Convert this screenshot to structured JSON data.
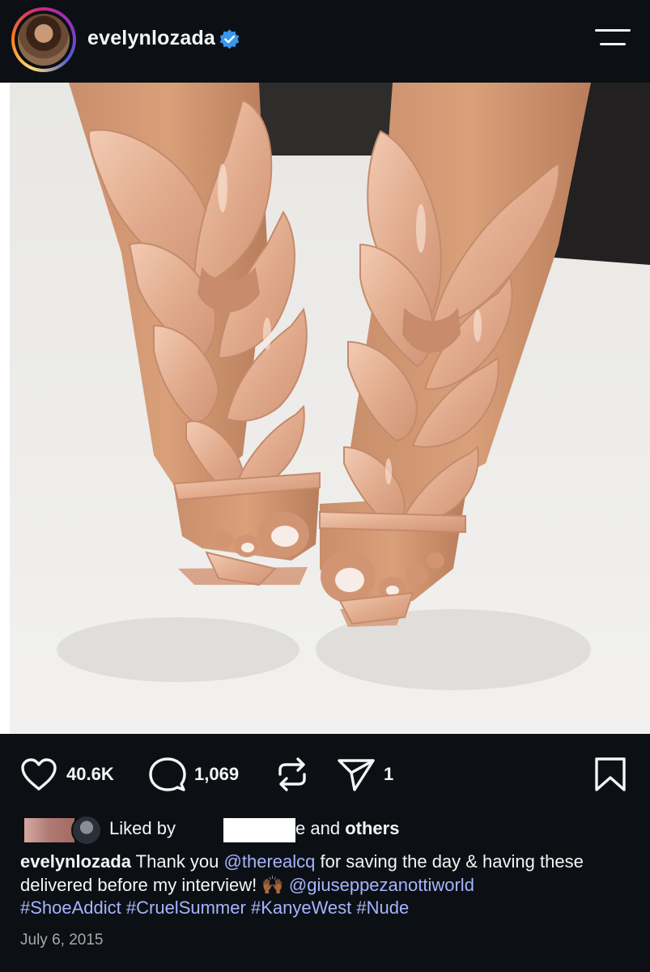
{
  "header": {
    "username": "evelynlozada",
    "verified_icon": "verified-badge-icon",
    "menu_icon": "menu-icon",
    "accent": "#3897f0"
  },
  "post": {
    "image_alt_icon": "photo-sandals"
  },
  "actions": {
    "likes": "40.6K",
    "comments": "1,069",
    "shares": "1",
    "icons": [
      "heart-icon",
      "comment-icon",
      "repost-icon",
      "send-icon",
      "bookmark-icon"
    ]
  },
  "liked_by": {
    "prefix": "Liked by",
    "name_fragment": "e",
    "connector": "and",
    "others": "others"
  },
  "caption": {
    "username": "evelynlozada",
    "text_1": "Thank you",
    "mention_1": "@therealcq",
    "text_2": "for saving the day & having these delivered before my interview!",
    "emoji": "🙌🏾",
    "mention_2": "@giuseppezanottiworld",
    "tags": [
      "#ShoeAddict",
      "#CruelSummer",
      "#KanyeWest",
      "#Nude"
    ],
    "link_color": "#a5b4ff"
  },
  "date": "July 6, 2015"
}
